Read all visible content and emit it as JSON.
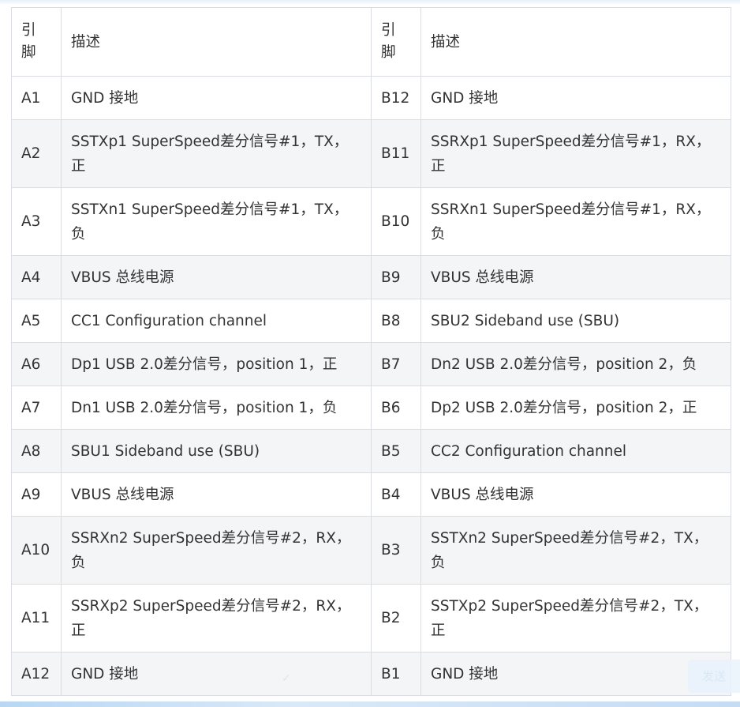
{
  "table": {
    "headers": [
      "引\n脚",
      "描述",
      "引\n脚",
      "描述"
    ],
    "rows": [
      {
        "pin_a": "A1",
        "desc_a": "GND 接地",
        "pin_b": "B12",
        "desc_b": "GND 接地",
        "tall": false
      },
      {
        "pin_a": "A2",
        "desc_a": "SSTXp1 SuperSpeed差分信号#1，TX，正",
        "pin_b": "B11",
        "desc_b": "SSRXp1 SuperSpeed差分信号#1，RX，正",
        "tall": true
      },
      {
        "pin_a": "A3",
        "desc_a": "SSTXn1 SuperSpeed差分信号#1，TX，负",
        "pin_b": "B10",
        "desc_b": "SSRXn1 SuperSpeed差分信号#1，RX，负",
        "tall": true
      },
      {
        "pin_a": "A4",
        "desc_a": "VBUS 总线电源",
        "pin_b": "B9",
        "desc_b": "VBUS 总线电源",
        "tall": false
      },
      {
        "pin_a": "A5",
        "desc_a": "CC1 Configuration channel",
        "pin_b": "B8",
        "desc_b": "SBU2 Sideband use (SBU)",
        "tall": false
      },
      {
        "pin_a": "A6",
        "desc_a": "Dp1 USB 2.0差分信号，position 1，正",
        "pin_b": "B7",
        "desc_b": "Dn2 USB 2.0差分信号，position 2，负",
        "tall": false
      },
      {
        "pin_a": "A7",
        "desc_a": "Dn1 USB 2.0差分信号，position 1，负",
        "pin_b": "B6",
        "desc_b": "Dp2 USB 2.0差分信号，position 2，正",
        "tall": false
      },
      {
        "pin_a": "A8",
        "desc_a": "SBU1 Sideband use (SBU)",
        "pin_b": "B5",
        "desc_b": "CC2 Configuration channel",
        "tall": false
      },
      {
        "pin_a": "A9",
        "desc_a": "VBUS 总线电源",
        "pin_b": "B4",
        "desc_b": "VBUS 总线电源",
        "tall": false
      },
      {
        "pin_a": "A10",
        "desc_a": "SSRXn2 SuperSpeed差分信号#2，RX，负",
        "pin_b": "B3",
        "desc_b": "SSTXn2 SuperSpeed差分信号#2，TX，负",
        "tall": true
      },
      {
        "pin_a": "A11",
        "desc_a": "SSRXp2 SuperSpeed差分信号#2，RX，正",
        "pin_b": "B2",
        "desc_b": "SSTXp2 SuperSpeed差分信号#2，TX，正",
        "tall": true
      },
      {
        "pin_a": "A12",
        "desc_a": "GND 接地",
        "pin_b": "B1",
        "desc_b": "GND 接地",
        "tall": false
      }
    ]
  },
  "send_button": {
    "label": "发送"
  },
  "colors": {
    "text": "#333333",
    "border": "#dadde2",
    "stripe": "#f4f5f7",
    "accent": "#b9d7f2"
  }
}
